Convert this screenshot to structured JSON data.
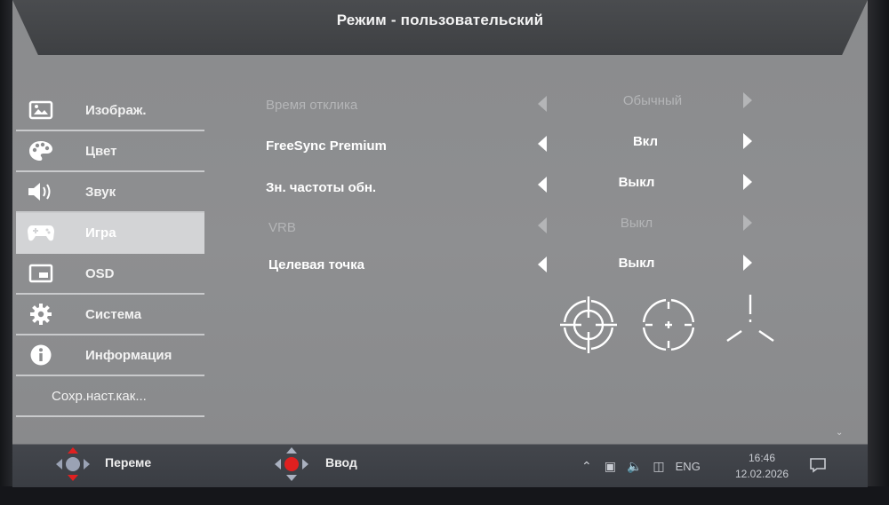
{
  "title": "Режим - пользовательский",
  "sidebar": {
    "items": [
      {
        "label": "Изображ.",
        "icon": "picture-icon"
      },
      {
        "label": "Цвет",
        "icon": "palette-icon"
      },
      {
        "label": "Звук",
        "icon": "speaker-icon"
      },
      {
        "label": "Игра",
        "icon": "gamepad-icon",
        "active": true
      },
      {
        "label": "OSD",
        "icon": "osd-window-icon"
      },
      {
        "label": "Система",
        "icon": "gear-icon"
      },
      {
        "label": "Информация",
        "icon": "info-icon"
      },
      {
        "label": "Сохр.наст.как..."
      }
    ]
  },
  "settings": [
    {
      "label": "Время отклика",
      "value": "Обычный",
      "enabled": false
    },
    {
      "label": "FreeSync Premium",
      "value": "Вкл",
      "enabled": true
    },
    {
      "label": "Зн. частоты обн.",
      "value": "Выкл",
      "enabled": true
    },
    {
      "label": "VRB",
      "value": "Выкл",
      "enabled": false
    },
    {
      "label": "Целевая точка",
      "value": "Выкл",
      "enabled": true
    }
  ],
  "crosshairs": [
    "crosshair-circle-target-icon",
    "crosshair-circle-dot-icon",
    "crosshair-tri-lines-icon"
  ],
  "hints": {
    "move_label": "Переме",
    "enter_label": "Ввод"
  },
  "taskbar": {
    "lang": "ENG",
    "time": "16:46",
    "date": "12.02.2026"
  },
  "colors": {
    "panel": "#8c8d8f",
    "title_bar": "#44464a",
    "active_item": "#d3d4d6",
    "hint_bar": "#3e4147",
    "accent_red": "#e02020"
  }
}
